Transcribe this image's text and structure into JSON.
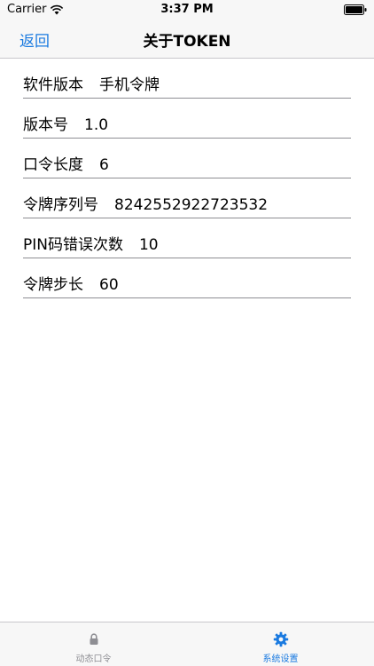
{
  "status_bar": {
    "carrier": "Carrier",
    "time": "3:37 PM"
  },
  "nav": {
    "back_label": "返回",
    "title": "关于TOKEN"
  },
  "info_rows": [
    {
      "label": "软件版本",
      "value": "手机令牌"
    },
    {
      "label": "版本号",
      "value": "1.0"
    },
    {
      "label": "口令长度",
      "value": "6"
    },
    {
      "label": "令牌序列号",
      "value": "8242552922723532"
    },
    {
      "label": "PIN码错误次数",
      "value": "10"
    },
    {
      "label": "令牌步长",
      "value": "60"
    }
  ],
  "tab_bar": {
    "tabs": [
      {
        "label": "动态口令",
        "icon": "lock-icon",
        "active": false
      },
      {
        "label": "系统设置",
        "icon": "gear-icon",
        "active": true
      }
    ]
  },
  "colors": {
    "accent": "#1a7ae0",
    "inactive": "#8e8e93"
  }
}
